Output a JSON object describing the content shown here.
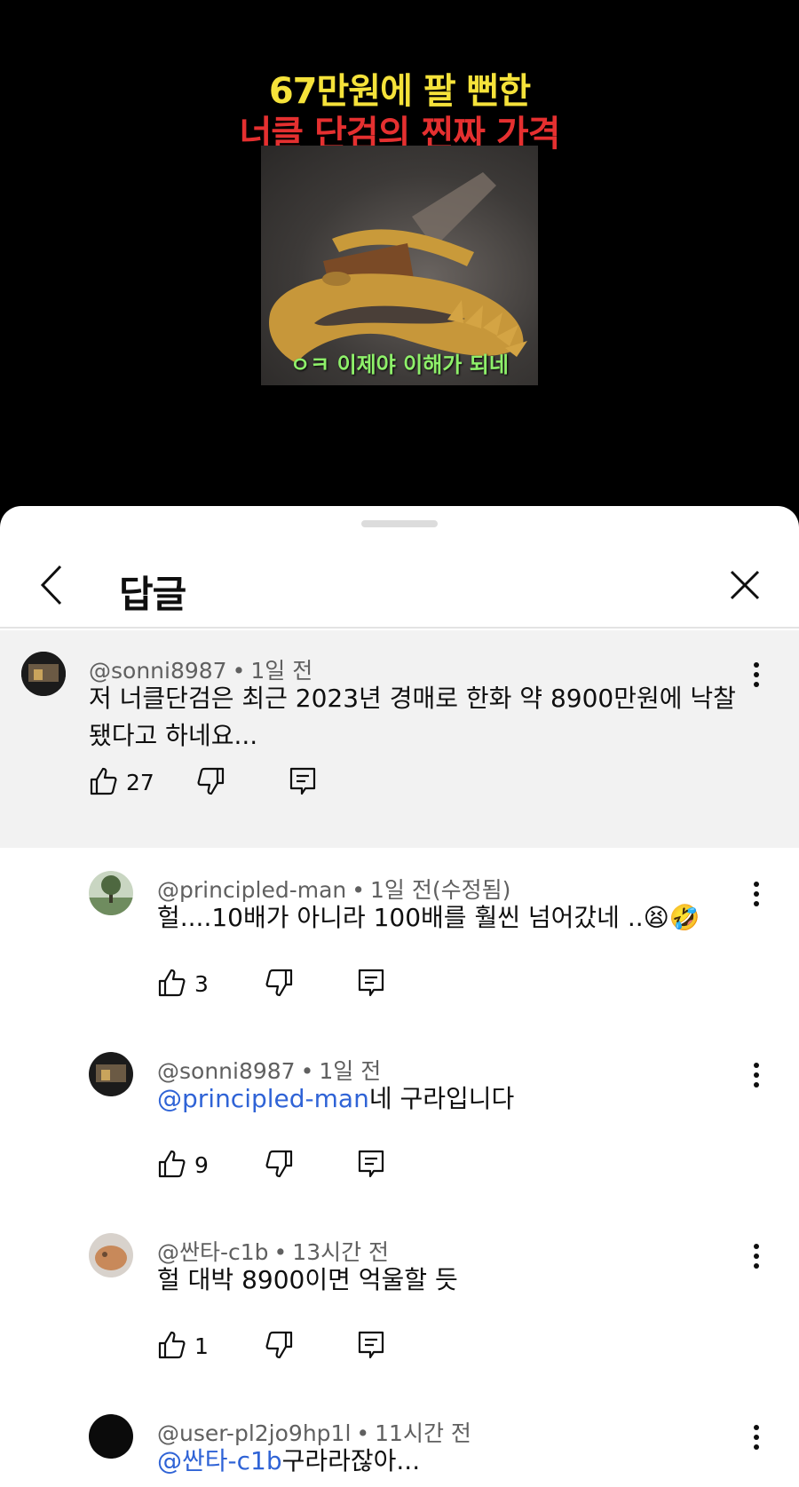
{
  "video": {
    "title_line1": "67만원에 팔 뻔한",
    "title_line2": "너클 단검의 찐짜 가격",
    "subtitle": "ㅇㅋ 이제야 이해가 되네"
  },
  "sheet": {
    "title": "답글"
  },
  "parent": {
    "author": "@sonni8987",
    "time": "1일 전",
    "text_line1": "저 너클단검은 최근 2023년 경매로 한화 약 8900만원에 낙찰",
    "text_line2": "됐다고 하네요...",
    "likes": "27"
  },
  "replies": [
    {
      "author": "@principled-man",
      "time": "1일 전(수정됨)",
      "text": "헐....10배가 아니라 100배를 훨씬 넘어갔네 ..😫🤣",
      "likes": "3"
    },
    {
      "author": "@sonni8987",
      "time": "1일 전",
      "mention": "@principled-man",
      "text": "네 구라입니다",
      "likes": "9"
    },
    {
      "author": "@싼타-c1b",
      "time": "13시간 전",
      "text": "헐 대박 8900이면 억울할 듯",
      "likes": "1"
    },
    {
      "author": "@user-pl2jo9hp1l",
      "time": "11시간 전",
      "mention": "@싼타-c1b",
      "text": "구라라잖아..."
    }
  ],
  "separator": "•",
  "icons": {
    "back": "chevron-left-icon",
    "close": "close-icon",
    "like": "thumb-up-icon",
    "dislike": "thumb-down-icon",
    "reply": "reply-icon",
    "more": "more-vert-icon"
  },
  "colors": {
    "mention": "#2f63d6",
    "highlight_bg": "#f2f2f2",
    "title_yellow": "#f5e23a",
    "title_red": "#e53030",
    "subtitle_green": "#8ef06a"
  }
}
